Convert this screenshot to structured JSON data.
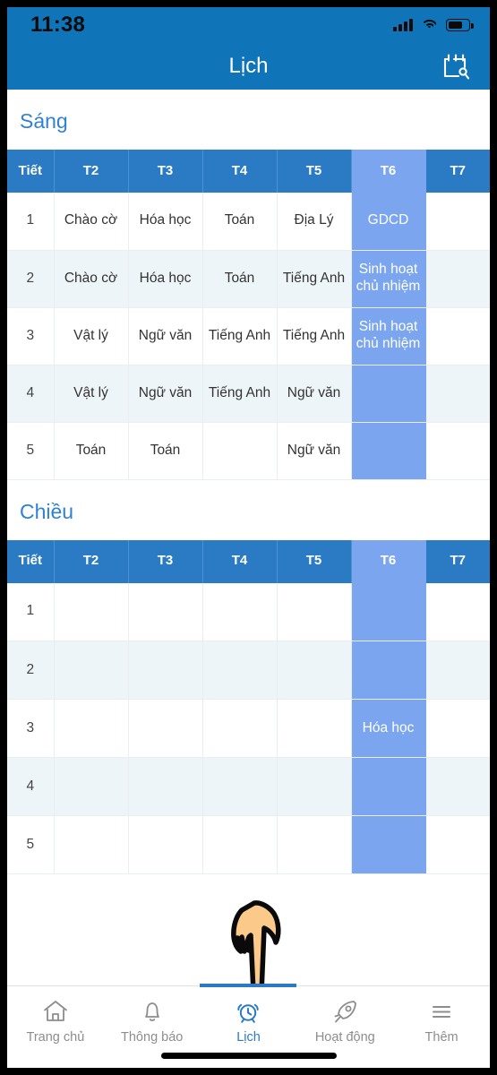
{
  "status_bar": {
    "time": "11:38",
    "signal_icon": "cellular-signal-icon",
    "wifi_icon": "wifi-icon",
    "battery_icon": "battery-icon"
  },
  "header": {
    "title": "Lịch",
    "action_icon": "calendar-settings-icon",
    "background_color": "#0f74b8"
  },
  "sections": [
    {
      "label": "Sáng",
      "table": {
        "columns": [
          "Tiết",
          "T2",
          "T3",
          "T4",
          "T5",
          "T6",
          "T7"
        ],
        "highlight_column_index": 5,
        "rows": [
          {
            "period": "1",
            "cells": [
              "Chào cờ",
              "Hóa học",
              "Toán",
              "Địa Lý",
              "GDCD",
              ""
            ]
          },
          {
            "period": "2",
            "cells": [
              "Chào cờ",
              "Hóa học",
              "Toán",
              "Tiếng Anh",
              "Sinh hoạt chủ nhiệm",
              ""
            ]
          },
          {
            "period": "3",
            "cells": [
              "Vật lý",
              "Ngữ văn",
              "Tiếng Anh",
              "Tiếng Anh",
              "Sinh hoạt chủ nhiệm",
              ""
            ]
          },
          {
            "period": "4",
            "cells": [
              "Vật lý",
              "Ngữ văn",
              "Tiếng Anh",
              "Ngữ văn",
              "",
              ""
            ]
          },
          {
            "period": "5",
            "cells": [
              "Toán",
              "Toán",
              "",
              "Ngữ văn",
              "",
              ""
            ]
          }
        ]
      }
    },
    {
      "label": "Chiều",
      "table": {
        "columns": [
          "Tiết",
          "T2",
          "T3",
          "T4",
          "T5",
          "T6",
          "T7"
        ],
        "highlight_column_index": 5,
        "rows": [
          {
            "period": "1",
            "cells": [
              "",
              "",
              "",
              "",
              "",
              ""
            ]
          },
          {
            "period": "2",
            "cells": [
              "",
              "",
              "",
              "",
              "",
              ""
            ]
          },
          {
            "period": "3",
            "cells": [
              "",
              "",
              "",
              "",
              "Hóa học",
              ""
            ]
          },
          {
            "period": "4",
            "cells": [
              "",
              "",
              "",
              "",
              "",
              ""
            ]
          },
          {
            "period": "5",
            "cells": [
              "",
              "",
              "",
              "",
              "",
              ""
            ]
          }
        ]
      }
    }
  ],
  "cursor": {
    "icon": "pointing-hand-cursor"
  },
  "tabbar": {
    "active_index": 2,
    "accent_color": "#2a7ac4",
    "items": [
      {
        "label": "Trang chủ",
        "icon": "home-icon"
      },
      {
        "label": "Thông báo",
        "icon": "bell-icon"
      },
      {
        "label": "Lịch",
        "icon": "alarm-clock-icon"
      },
      {
        "label": "Hoạt động",
        "icon": "rocket-icon"
      },
      {
        "label": "Thêm",
        "icon": "hamburger-menu-icon"
      }
    ]
  }
}
